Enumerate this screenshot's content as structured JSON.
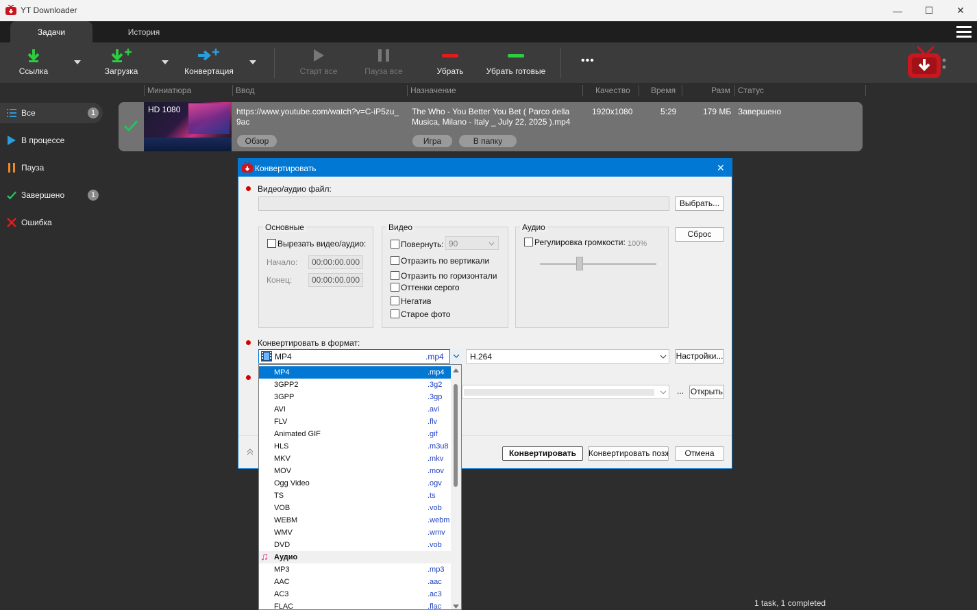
{
  "window": {
    "title": "YT Downloader",
    "minimize": "—",
    "maximize": "☐",
    "close": "✕"
  },
  "tabs": [
    {
      "label": "Задачи",
      "active": true
    },
    {
      "label": "История",
      "active": false
    }
  ],
  "toolbar": {
    "link": "Ссылка",
    "download": "Загрузка",
    "convert": "Конвертация",
    "start_all": "Старт все",
    "pause_all": "Пауза все",
    "remove": "Убрать",
    "remove_done": "Убрать готовые",
    "more": "•••"
  },
  "columns": {
    "thumb": "Миниатюра",
    "input": "Ввод",
    "dest": "Назначение",
    "quality": "Качество",
    "time": "Время",
    "size": "Разм",
    "status": "Статус"
  },
  "sidebar": [
    {
      "label": "Все",
      "count": "1"
    },
    {
      "label": "В процессе",
      "count": ""
    },
    {
      "label": "Пауза",
      "count": ""
    },
    {
      "label": "Завершено",
      "count": "1"
    },
    {
      "label": "Ошибка",
      "count": ""
    }
  ],
  "task": {
    "thumb_label": "HD 1080",
    "url_line1": "https://www.youtube.com/watch?v=C-iP5zu_",
    "url_line2": "9ac",
    "browse": "Обзор",
    "dest_line1": "The Who - You Better You Bet ( Parco della",
    "dest_line2": "Musica, Milano - Italy _ July 22, 2025 ).mp4",
    "play": "Игра",
    "folder": "В папку",
    "quality": "1920x1080",
    "time": "5:29",
    "size": "179 МБ",
    "status": "Завершено"
  },
  "statusbar": "1 task, 1 completed",
  "dialog": {
    "title": "Конвертировать",
    "file_label": "Видео/аудио файл:",
    "choose": "Выбрать...",
    "reset": "Сброс",
    "basic": {
      "title": "Основные",
      "cut": "Вырезать видео/аудио:",
      "start_label": "Начало:",
      "end_label": "Конец:",
      "start": "00:00:00.000",
      "end": "00:00:00.000"
    },
    "video": {
      "title": "Видео",
      "rotate": "Повернуть:",
      "rotate_value": "90",
      "flip_v": "Отразить по вертикали",
      "flip_h": "Отразить по горизонтали",
      "gray": "Оттенки серого",
      "negative": "Негатив",
      "old": "Старое фото"
    },
    "audio": {
      "title": "Аудио",
      "volume": "Регулировка громкости:",
      "volume_value": "100%"
    },
    "format_label": "Конвертировать в формат:",
    "format_value": "MP4",
    "format_ext": ".mp4",
    "codec": "H.264",
    "settings": "Настройки...",
    "dots": "...",
    "open": "Открыть",
    "convert": "Конвертировать",
    "convert_later": "Конвертировать позже",
    "cancel": "Отмена"
  },
  "format_list": [
    {
      "name": "MP4",
      "ext": ".mp4",
      "selected": true
    },
    {
      "name": "3GPP2",
      "ext": ".3g2"
    },
    {
      "name": "3GPP",
      "ext": ".3gp"
    },
    {
      "name": "AVI",
      "ext": ".avi"
    },
    {
      "name": "FLV",
      "ext": ".flv"
    },
    {
      "name": "Animated GIF",
      "ext": ".gif"
    },
    {
      "name": "HLS",
      "ext": ".m3u8"
    },
    {
      "name": "MKV",
      "ext": ".mkv"
    },
    {
      "name": "MOV",
      "ext": ".mov"
    },
    {
      "name": "Ogg Video",
      "ext": ".ogv"
    },
    {
      "name": "TS",
      "ext": ".ts"
    },
    {
      "name": "VOB",
      "ext": ".vob"
    },
    {
      "name": "WEBM",
      "ext": ".webm"
    },
    {
      "name": "WMV",
      "ext": ".wmv"
    },
    {
      "name": "DVD",
      "ext": ".vob"
    },
    {
      "name": "Аудио",
      "ext": "",
      "header": true
    },
    {
      "name": "MP3",
      "ext": ".mp3"
    },
    {
      "name": "AAC",
      "ext": ".aac"
    },
    {
      "name": "AC3",
      "ext": ".ac3"
    },
    {
      "name": "FLAC",
      "ext": ".flac"
    }
  ],
  "colors": {
    "accent": "#0078d4",
    "green": "#22c55e",
    "red": "#e31b1b",
    "blue": "#2d9cdb",
    "orange": "#f08a24"
  }
}
